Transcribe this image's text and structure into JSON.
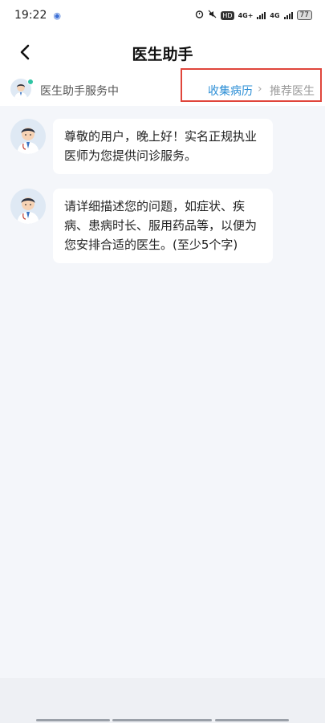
{
  "status_bar": {
    "time": "19:22",
    "app_indicator": "◉",
    "hd_label": "HD",
    "network_1": "4G+",
    "network_2": "4G",
    "battery": "77"
  },
  "header": {
    "title": "医生助手",
    "back_icon": "chevron-left-icon"
  },
  "subbar": {
    "status_text": "医生助手服务中",
    "steps": {
      "current": "收集病历",
      "separator": "›",
      "next": "推荐医生"
    }
  },
  "messages": [
    {
      "sender": "doctor-avatar",
      "text": "尊敬的用户，晚上好！实名正规执业医师为您提供问诊服务。"
    },
    {
      "sender": "doctor-avatar",
      "text": "请详细描述您的问题，如症状、疾病、患病时长、服用药品等，以便为您安排合适的医生。(至少5个字)"
    }
  ],
  "colors": {
    "accent": "#2d8fd6",
    "highlight_border": "#e0453b",
    "online_dot": "#2ec4a3",
    "background": "#f4f6fa"
  }
}
